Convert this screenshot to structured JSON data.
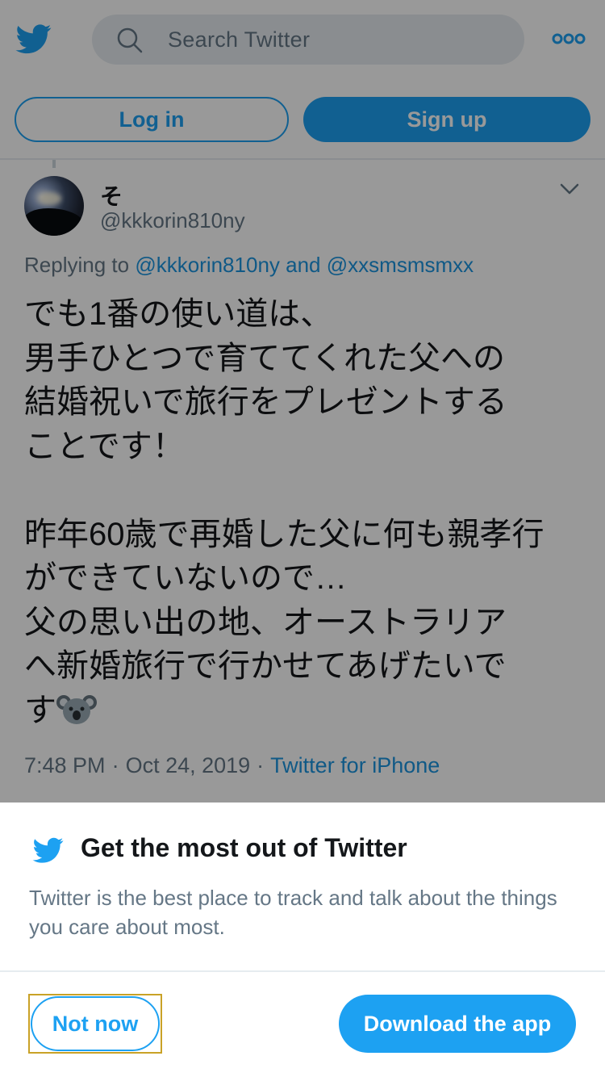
{
  "header": {
    "search_placeholder": "Search Twitter",
    "login_label": "Log in",
    "signup_label": "Sign up",
    "icons": {
      "logo": "twitter-bird-icon",
      "search": "search-icon",
      "more": "more-options-icon"
    }
  },
  "tweet": {
    "display_name": "そ",
    "handle": "@kkkorin810ny",
    "replying_prefix": "Replying to",
    "replying_mention_1": "@kkkorin810ny",
    "replying_and": "and",
    "replying_mention_2": "@xxsmsmsmxx",
    "text": "でも1番の使い道は、\n男手ひとつで育ててくれた父への\n結婚祝いで旅行をプレゼントする\nことです！\n\n昨年60歳で再婚した父に何も親孝行\nができていないので…\n父の思い出の地、オーストラリア\nへ新婚旅行で行かせてあげたいで\nす",
    "emoji": "koala",
    "time": "7:48 PM",
    "separator": "·",
    "date": "Oct 24, 2019",
    "source": "Twitter for iPhone"
  },
  "sheet": {
    "title": "Get the most out of Twitter",
    "description": "Twitter is the best place to track and talk about the things you care about most.",
    "not_now_label": "Not now",
    "download_label": "Download the app"
  },
  "colors": {
    "brand": "#1da1f2",
    "link": "#1b95e0",
    "secondary_text": "#657786",
    "overlay": "rgba(0,0,0,0.4)",
    "focus_outline": "#c9a227"
  }
}
